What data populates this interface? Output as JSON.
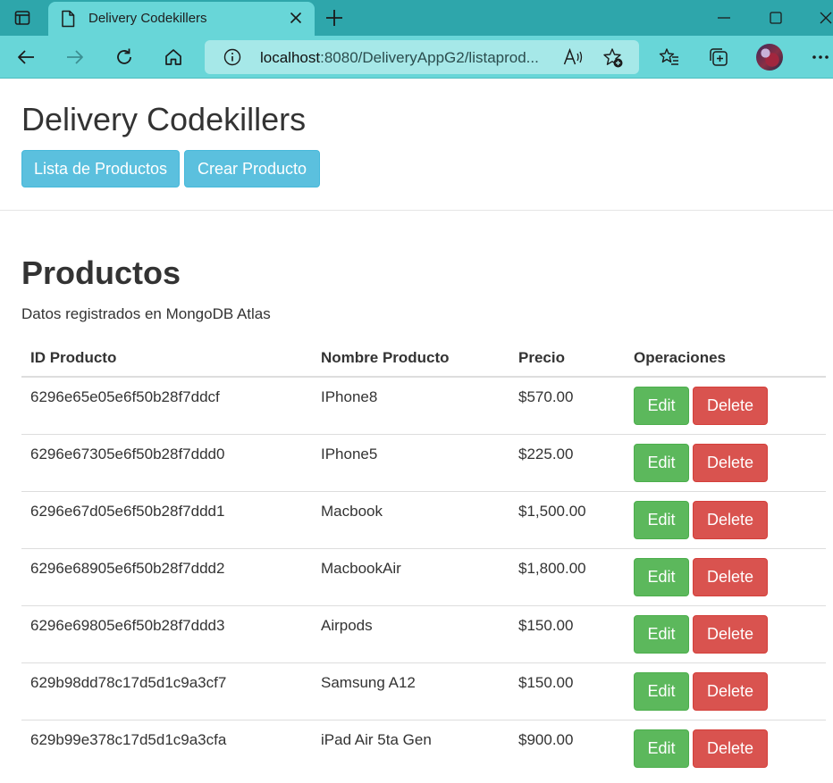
{
  "browser": {
    "tab_title": "Delivery Codekillers",
    "url_host": "localhost",
    "url_rest": ":8080/DeliveryAppG2/listaprod...",
    "icons": {
      "tab_actions": "tab-actions-icon",
      "favicon": "page-icon",
      "tab_close": "close-icon",
      "new_tab": "plus-icon",
      "minimize": "minimize-icon",
      "maximize": "maximize-icon",
      "close_window": "close-icon",
      "back": "back-arrow-icon",
      "forward": "forward-arrow-icon",
      "refresh": "refresh-icon",
      "home": "home-icon",
      "site_info": "info-icon",
      "read_aloud": "read-aloud-icon",
      "add_favorite": "star-plus-icon",
      "favorites": "favorites-list-icon",
      "collections": "collections-icon",
      "profile": "avatar",
      "more": "more-icon"
    },
    "colors": {
      "tabbar": "#2ea6ab",
      "toolbar": "#68d6d8",
      "address": "#a6e8e8"
    }
  },
  "page": {
    "site_title": "Delivery Codekillers",
    "nav": {
      "list_products": "Lista de Productos",
      "create_product": "Crear Producto"
    },
    "section_title": "Productos",
    "section_subtitle": "Datos registrados en MongoDB Atlas",
    "table": {
      "headers": [
        "ID Producto",
        "Nombre Producto",
        "Precio",
        "Operaciones"
      ],
      "rows": [
        {
          "id": "6296e65e05e6f50b28f7ddcf",
          "name": "IPhone8",
          "price": "$570.00",
          "edit": "Edit",
          "delete": "Delete"
        },
        {
          "id": "6296e67305e6f50b28f7ddd0",
          "name": "IPhone5",
          "price": "$225.00",
          "edit": "Edit",
          "delete": "Delete"
        },
        {
          "id": "6296e67d05e6f50b28f7ddd1",
          "name": "Macbook",
          "price": "$1,500.00",
          "edit": "Edit",
          "delete": "Delete"
        },
        {
          "id": "6296e68905e6f50b28f7ddd2",
          "name": "MacbookAir",
          "price": "$1,800.00",
          "edit": "Edit",
          "delete": "Delete"
        },
        {
          "id": "6296e69805e6f50b28f7ddd3",
          "name": "Airpods",
          "price": "$150.00",
          "edit": "Edit",
          "delete": "Delete"
        },
        {
          "id": "629b98dd78c17d5d1c9a3cf7",
          "name": "Samsung A12",
          "price": "$150.00",
          "edit": "Edit",
          "delete": "Delete"
        },
        {
          "id": "629b99e378c17d5d1c9a3cfa",
          "name": "iPad Air 5ta Gen",
          "price": "$900.00",
          "edit": "Edit",
          "delete": "Delete"
        }
      ]
    },
    "colors": {
      "info": "#5bc0de",
      "success": "#5cb85c",
      "danger": "#d9534f"
    }
  }
}
